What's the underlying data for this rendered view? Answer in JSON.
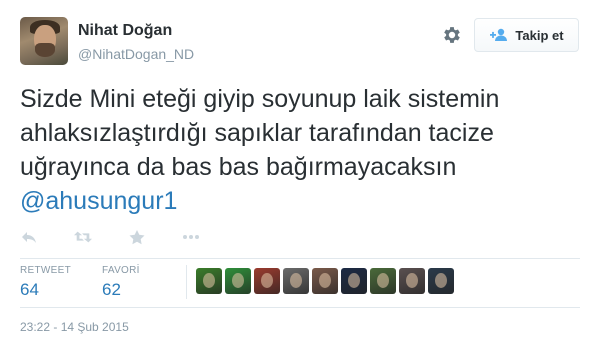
{
  "user": {
    "fullname": "Nihat Doğan",
    "username": "@NihatDogan_ND"
  },
  "follow_button": {
    "label": "Takip et"
  },
  "tweet": {
    "text": "Sizde Mini eteği giyip soyunup laik sistemin ahlaksızlaştırdığı sapıklar tarafından tacize uğrayınca da bas bas bağırmayacaksın",
    "mention": "@ahusungur1"
  },
  "actions": [
    {
      "name": "reply-icon"
    },
    {
      "name": "retweet-icon"
    },
    {
      "name": "favorite-icon"
    },
    {
      "name": "more-icon"
    }
  ],
  "stats": {
    "retweet_label": "RETWEET",
    "retweet_count": "64",
    "favorite_label": "FAVORİ",
    "favorite_count": "62"
  },
  "favoriters_avatars": [
    {
      "color": "#3a7d2a"
    },
    {
      "color": "#2f8f3a"
    },
    {
      "color": "#9b3b2e"
    },
    {
      "color": "#6b6b6b"
    },
    {
      "color": "#7a5a4a"
    },
    {
      "color": "#1c2a44"
    },
    {
      "color": "#4a6a3a"
    },
    {
      "color": "#5a5050"
    },
    {
      "color": "#2a3a4a"
    }
  ],
  "timestamp": "23:22 - 14 Şub 2015",
  "colors": {
    "link": "#2b7bb9",
    "muted": "#8899a6",
    "text": "#292f33"
  }
}
